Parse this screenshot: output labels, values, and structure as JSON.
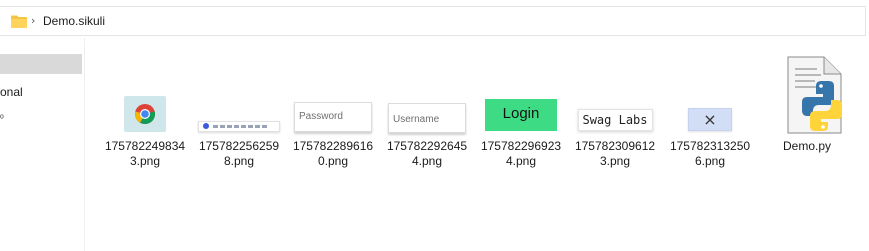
{
  "address_bar": {
    "folder_icon": "folder-icon",
    "separator": "›",
    "path": "Demo.sikuli"
  },
  "nav_pane": {
    "partial_label": "onal",
    "partial_glyph": "ᵒ"
  },
  "files": [
    {
      "name_line1": "175782249834",
      "name_line2": "3.png",
      "thumb": "chrome-logo"
    },
    {
      "name_line1": "175782256259",
      "name_line2": "8.png",
      "thumb": "search-bar"
    },
    {
      "name_line1": "175782289616",
      "name_line2": "0.png",
      "thumb": "password-field",
      "thumb_text": "Password"
    },
    {
      "name_line1": "175782292645",
      "name_line2": "4.png",
      "thumb": "username-field",
      "thumb_text": "Username"
    },
    {
      "name_line1": "175782296923",
      "name_line2": "4.png",
      "thumb": "login-button",
      "thumb_text": "Login"
    },
    {
      "name_line1": "175782309612",
      "name_line2": "3.png",
      "thumb": "swag-labs-title",
      "thumb_text": "Swag Labs"
    },
    {
      "name_line1": "175782313250",
      "name_line2": "6.png",
      "thumb": "close-button",
      "thumb_text": "×"
    },
    {
      "name_line1": "Demo.py",
      "name_line2": "",
      "thumb": "python-file-icon"
    }
  ],
  "colors": {
    "login_green": "#3ddc84",
    "close_blue": "#d2ddf6",
    "chrome_bg": "#cfe6ea",
    "folder_yellow": "#f4c542"
  }
}
